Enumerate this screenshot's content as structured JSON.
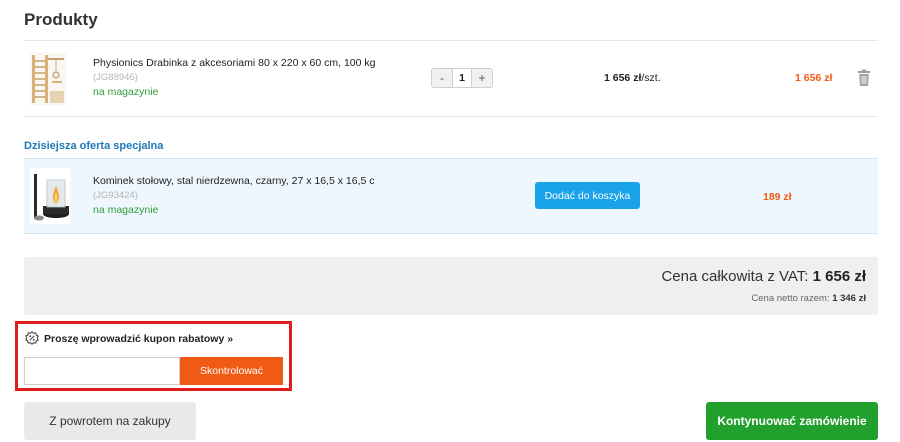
{
  "products": {
    "title": "Produkty",
    "items": [
      {
        "name": "Physionics Drabinka z akcesoriami 80 x 220 x 60 cm, 100 kg",
        "code": "(JG88946)",
        "stock": "na magazynie",
        "qty_minus": "-",
        "qty": "1",
        "qty_plus": "+",
        "unit_price": "1 656 zł",
        "unit_suffix": "/szt.",
        "total": "1 656 zł",
        "image_icon": "wall-bars-product-image",
        "delete_icon": "trash-icon"
      }
    ]
  },
  "offer": {
    "title": "Dzisiejsza oferta specjalna",
    "name": "Kominek stołowy, stal nierdzewna, czarny, 27 x 16,5 x 16,5 c",
    "code": "(JG93424)",
    "stock": "na magazynie",
    "add_button": "Dodać do koszyka",
    "price": "189 zł",
    "image_icon": "table-fireplace-product-image"
  },
  "totals": {
    "gross_label": "Cena całkowita z VAT: ",
    "gross_value": "1 656 zł",
    "net_label": "Cena netto razem: ",
    "net_value": "1 346 zł"
  },
  "coupon": {
    "icon": "discount-badge-icon",
    "label": "Proszę wprowadzić kupon rabatowy »",
    "input_value": "",
    "input_placeholder": "",
    "button": "Skontrolować"
  },
  "actions": {
    "back": "Z powrotem na zakupy",
    "continue": "Kontynuować zamówienie"
  },
  "colors": {
    "accent_orange": "#ef5a14",
    "stock_green": "#2e9e3c",
    "offer_blue": "#1d7ab8",
    "add_button_blue": "#19a3eb",
    "continue_green": "#22a02e",
    "highlight_red": "#e01b1b"
  }
}
